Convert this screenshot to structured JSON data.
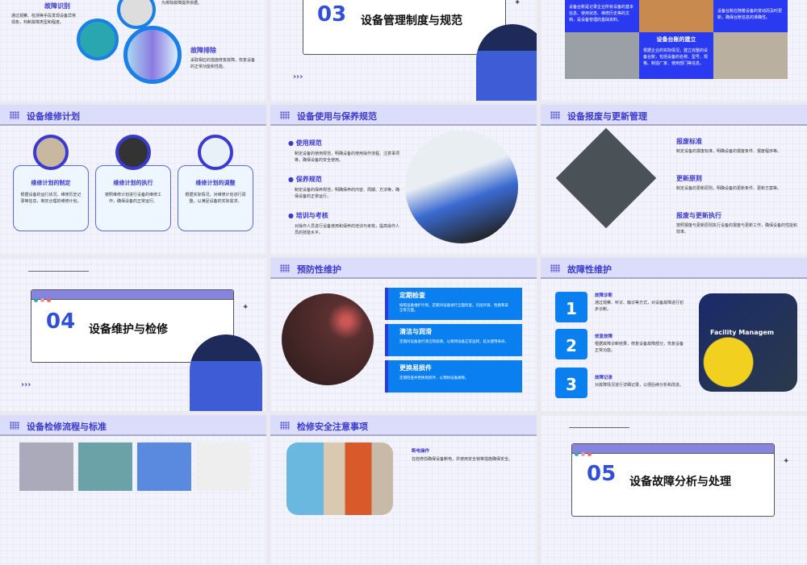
{
  "slides": {
    "s1": {
      "item1_title": "故障识别",
      "item1_desc": "通过观察、检测等手段发现设备异常现象，判断故障类型和程度。",
      "item2_desc_tail": "为排除故障提供依据。",
      "item3_title": "故障排除",
      "item3_desc": "采取相应的措施修复故障，恢复设备的正常功能和性能。"
    },
    "s2": {
      "number": "03",
      "title": "设备管理制度与规范"
    },
    "s3": {
      "desc1": "设备台账是记录企业所有设备的基本信息、使用状态、维修历史等的文档，是设备管理的基础资料。",
      "desc2": "设备台账应随着设备的变动而及时更新，确保台账信息的准确性。",
      "center_title": "设备台账的建立",
      "center_desc": "根据企业的实际情况，建立完整的设备台账，包括设备的名称、型号、规格、制造厂家、使用部门等信息。"
    },
    "s4": {
      "title": "设备维修计划",
      "cards": [
        {
          "title": "维修计划的制定",
          "desc": "根据设备的运行状况、维修历史记录等信息，制定合理的维修计划。"
        },
        {
          "title": "维修计划的执行",
          "desc": "按照维修计划进行设备的维修工作，确保设备的正常运行。"
        },
        {
          "title": "维修计划的调整",
          "desc": "根据实际情况，对维修计划进行调整，以满足设备的实际需求。"
        }
      ]
    },
    "s5": {
      "title": "设备使用与保养规范",
      "items": [
        {
          "title": "使用规范",
          "desc": "制定设备的使用规范，明确设备的使用操作流程、注意事项等，确保设备的安全使用。"
        },
        {
          "title": "保养规范",
          "desc": "制定设备的保养规范，明确保养的内容、周期、方法等，确保设备的正常运行。"
        },
        {
          "title": "培训与考核",
          "desc": "对操作人员进行设备使用和保养的培训与考核，提高操作人员的技能水平。"
        }
      ]
    },
    "s6": {
      "title": "设备报废与更新管理",
      "items": [
        {
          "title": "报废标准",
          "desc": "制定设备的报废标准，明确设备的报废条件、报废程序等。"
        },
        {
          "title": "更新原则",
          "desc": "制定设备的更新原则，明确设备的更新条件、更新方案等。"
        },
        {
          "title": "报废与更新执行",
          "desc": "按照报废与更新原则执行设备的报废与更新工作，确保设备的性能和效率。"
        }
      ]
    },
    "s7": {
      "number": "04",
      "title": "设备维护与检修"
    },
    "s8": {
      "title": "预防性维护",
      "items": [
        {
          "title": "定期检查",
          "desc": "按照设备维护计划，定期对设备进行全面检查，包括外观、性能和安全等方面。"
        },
        {
          "title": "清洁与润滑",
          "desc": "定期对设备进行清洁和润滑，以保持设备正常运转，延长使用寿命。"
        },
        {
          "title": "更换易损件",
          "desc": "定期检查并更换易损件，以预防设备故障。"
        }
      ]
    },
    "s9": {
      "title": "故障性维护",
      "items": [
        {
          "num": "1",
          "title": "故障诊断",
          "desc": "通过观察、听诊、触诊等方式，对设备故障进行初步诊断。"
        },
        {
          "num": "2",
          "title": "修复故障",
          "desc": "根据故障诊断结果，修复设备故障部分，恢复设备正常功能。"
        },
        {
          "num": "3",
          "title": "故障记录",
          "desc": "对故障情况进行详细记录，以便后续分析和改进。"
        }
      ],
      "image_text": "Facility Managem"
    },
    "s10": {
      "title": "设备检修流程与标准"
    },
    "s11": {
      "title": "检修安全注意事项",
      "item_title": "断电操作",
      "item_desc": "在检修前确保设备断电，并使用安全锁等措施确保安全。"
    },
    "s12": {
      "number": "05",
      "title": "设备故障分析与处理"
    }
  },
  "colors": {
    "accent": "#3a3ad0",
    "blue": "#0a7ff0",
    "header": "#dcdcfb"
  }
}
